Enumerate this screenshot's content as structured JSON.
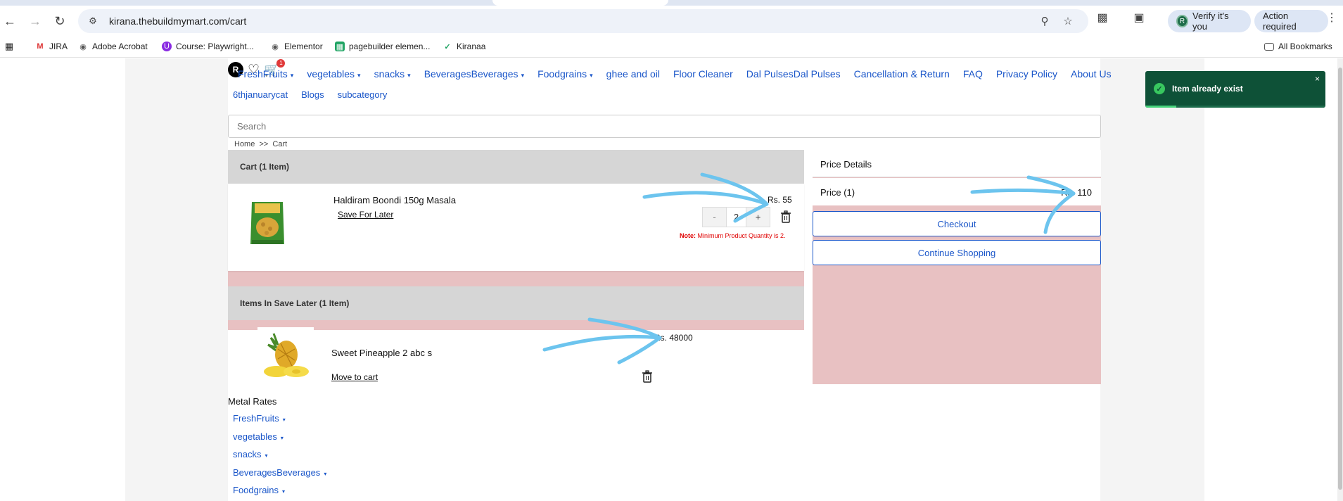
{
  "browser": {
    "url": "kirana.thebuildmymart.com/cart",
    "verify_label": "Verify it's you",
    "verify_avatar": "R",
    "action_label": "Action required"
  },
  "bookmarks": [
    {
      "label": "JIRA",
      "icon": "gmail-icon"
    },
    {
      "label": "Adobe Acrobat",
      "icon": "globe-icon"
    },
    {
      "label": "Course: Playwright...",
      "icon": "course-icon"
    },
    {
      "label": "Elementor",
      "icon": "globe-icon"
    },
    {
      "label": "pagebuilder elemen...",
      "icon": "sheets-icon"
    },
    {
      "label": "Kiranaa",
      "icon": "check-icon"
    }
  ],
  "all_bookmarks": "All Bookmarks",
  "header": {
    "user_initial": "R",
    "cart_count": "1"
  },
  "menu_row1": [
    {
      "label": "FreshFruits",
      "dropdown": true
    },
    {
      "label": "vegetables",
      "dropdown": true
    },
    {
      "label": "snacks",
      "dropdown": true
    },
    {
      "label": "BeveragesBeverages",
      "dropdown": true
    },
    {
      "label": "Foodgrains",
      "dropdown": true
    },
    {
      "label": "ghee and oil",
      "dropdown": false
    },
    {
      "label": "Floor Cleaner",
      "dropdown": false
    },
    {
      "label": "Dal PulsesDal Pulses",
      "dropdown": false
    },
    {
      "label": "Cancellation & Return",
      "dropdown": false
    },
    {
      "label": "FAQ",
      "dropdown": false
    },
    {
      "label": "Privacy Policy",
      "dropdown": false
    },
    {
      "label": "About Us",
      "dropdown": false
    }
  ],
  "menu_row2": [
    {
      "label": "6thjanuarycat"
    },
    {
      "label": "Blogs"
    },
    {
      "label": "subcategory"
    }
  ],
  "search": {
    "placeholder": "Search"
  },
  "breadcrumb": "Home  >>  Cart",
  "cart": {
    "heading": "Cart (1 Item)",
    "item": {
      "name": "Haldiram Boondi 150g Masala",
      "save_later": "Save For Later",
      "price": "Rs. 55",
      "qty_minus": "-",
      "qty_value": "2",
      "qty_plus": "+",
      "note_label": "Note:",
      "note_text": " Minimum Product Quantity is 2."
    }
  },
  "save_later": {
    "heading": "Items In Save Later (1 Item)",
    "item": {
      "name": "Sweet Pineapple 2 abc s",
      "price": "Rs. 48000",
      "move_to_cart": "Move to cart"
    }
  },
  "price_details": {
    "heading": "Price Details",
    "price_label": "Price (1)",
    "price_value": "Rs. 110",
    "checkout": "Checkout",
    "continue": "Continue Shopping"
  },
  "footer": {
    "metal_rates": "Metal Rates",
    "menu": [
      {
        "label": "FreshFruits"
      },
      {
        "label": "vegetables"
      },
      {
        "label": "snacks"
      },
      {
        "label": "BeveragesBeverages"
      },
      {
        "label": "Foodgrains"
      }
    ]
  },
  "toast": {
    "message": "Item already exist",
    "close": "×",
    "progress": 0.17
  },
  "colors": {
    "link": "#1a56c9",
    "panel_pink": "#e8c1c2",
    "toast_bg": "#0e5137",
    "annotation": "#6cc4ee"
  }
}
